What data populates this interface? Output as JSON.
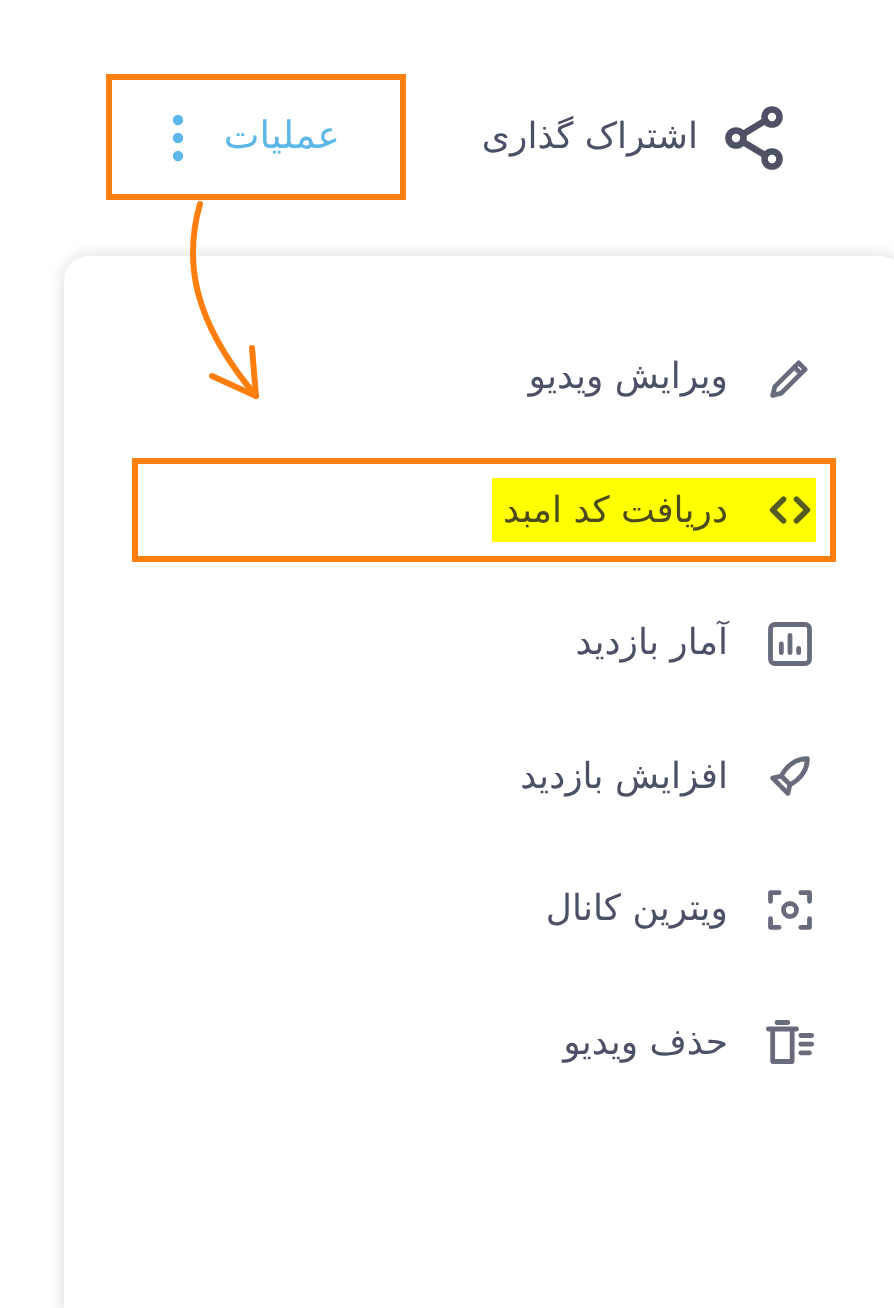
{
  "header": {
    "share": {
      "label": "اشتراک گذاری"
    },
    "actions": {
      "label": "عملیات",
      "annotated": true
    }
  },
  "menu": {
    "items": [
      {
        "kind": "edit",
        "label": "ویرایش ویدیو",
        "highlighted": false
      },
      {
        "kind": "embed",
        "label": "دریافت کد امبد",
        "highlighted": true
      },
      {
        "kind": "stats",
        "label": "آمار بازدید",
        "highlighted": false
      },
      {
        "kind": "boost",
        "label": "افزایش بازدید",
        "highlighted": false
      },
      {
        "kind": "showcase",
        "label": "ویترین کانال",
        "highlighted": false
      },
      {
        "kind": "delete",
        "label": "حذف ویدیو",
        "highlighted": false
      }
    ]
  }
}
